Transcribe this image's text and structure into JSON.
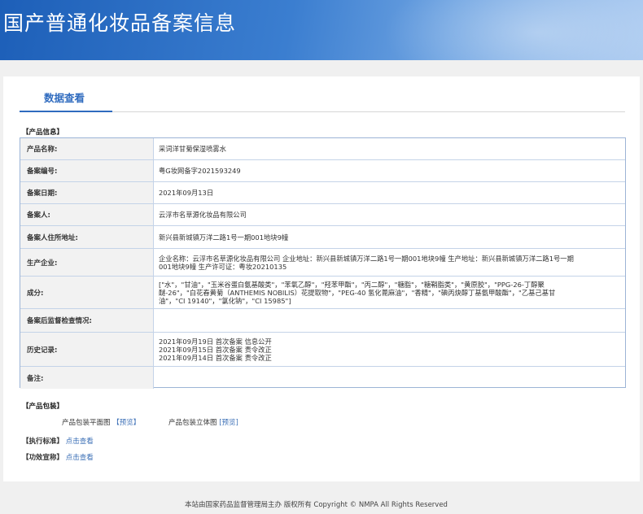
{
  "header": {
    "title": "国产普通化妆品备案信息"
  },
  "tabs": [
    {
      "label": "数据查看"
    }
  ],
  "sections": {
    "product_info": "【产品信息】",
    "packaging": "【产品包装】",
    "standard": "【执行标准】",
    "efficacy": "【功效宣称】"
  },
  "rows": [
    {
      "label": "产品名称:",
      "lines": [
        "采词洋甘菊保湿喷雾水"
      ]
    },
    {
      "label": "备案编号:",
      "lines": [
        "粤G妆网备字2021593249"
      ]
    },
    {
      "label": "备案日期:",
      "lines": [
        "2021年09月13日"
      ]
    },
    {
      "label": "备案人:",
      "lines": [
        "云浮市名草源化妆品有限公司"
      ]
    },
    {
      "label": "备案人住所地址:",
      "lines": [
        "新兴县新城镇万洋二路1号一期001地块9幢"
      ]
    },
    {
      "label": "生产企业:",
      "lines": [
        "企业名称：云浮市名草源化妆品有限公司 企业地址：新兴县新城镇万洋二路1号一期001地块9幢 生产地址：新兴县新城镇万洋二路1号一期",
        "001地块9幢 生产许可证：粤妆20210135"
      ]
    },
    {
      "label": "成分:",
      "lines": [
        "[\"水\"，\"甘油\"，\"玉米谷蛋白氨基酸类\"，\"苯氧乙醇\"，\"羟苯甲酯\"，\"丙二醇\"，\"糖脂\"，\"糖鞘脂类\"，\"黄原胶\"，\"PPG-26-丁醇聚",
        "醚-26\"，\"白花春黄菊（ANTHEMIS NOBILIS）花提取物\"，\"PEG-40 氢化蓖麻油\"，\"香精\"，\"碘丙炔醇丁基氨甲酸酯\"，\"乙基己基甘",
        "油\"，\"CI 19140\"，\"氯化钠\"，\"CI 15985\"]"
      ]
    },
    {
      "label": "备案后监督检查情况:",
      "lines": []
    },
    {
      "label": "历史记录:",
      "lines": [
        "2021年09月19日 首次备案 信息公开",
        "2021年09月15日 首次备案 责令改正",
        "2021年09月14日 首次备案 责令改正"
      ]
    },
    {
      "label": "备注:",
      "lines": []
    }
  ],
  "packaging": {
    "flat_label": "产品包装平面图",
    "solid_label": "产品包装立体图",
    "preview_link": "【预览】",
    "preview_link2": "[预览]"
  },
  "view_link": "点击查看",
  "footer": {
    "text": "本站由国家药品监督管理局主办 版权所有 Copyright © NMPA All Rights Reserved"
  }
}
